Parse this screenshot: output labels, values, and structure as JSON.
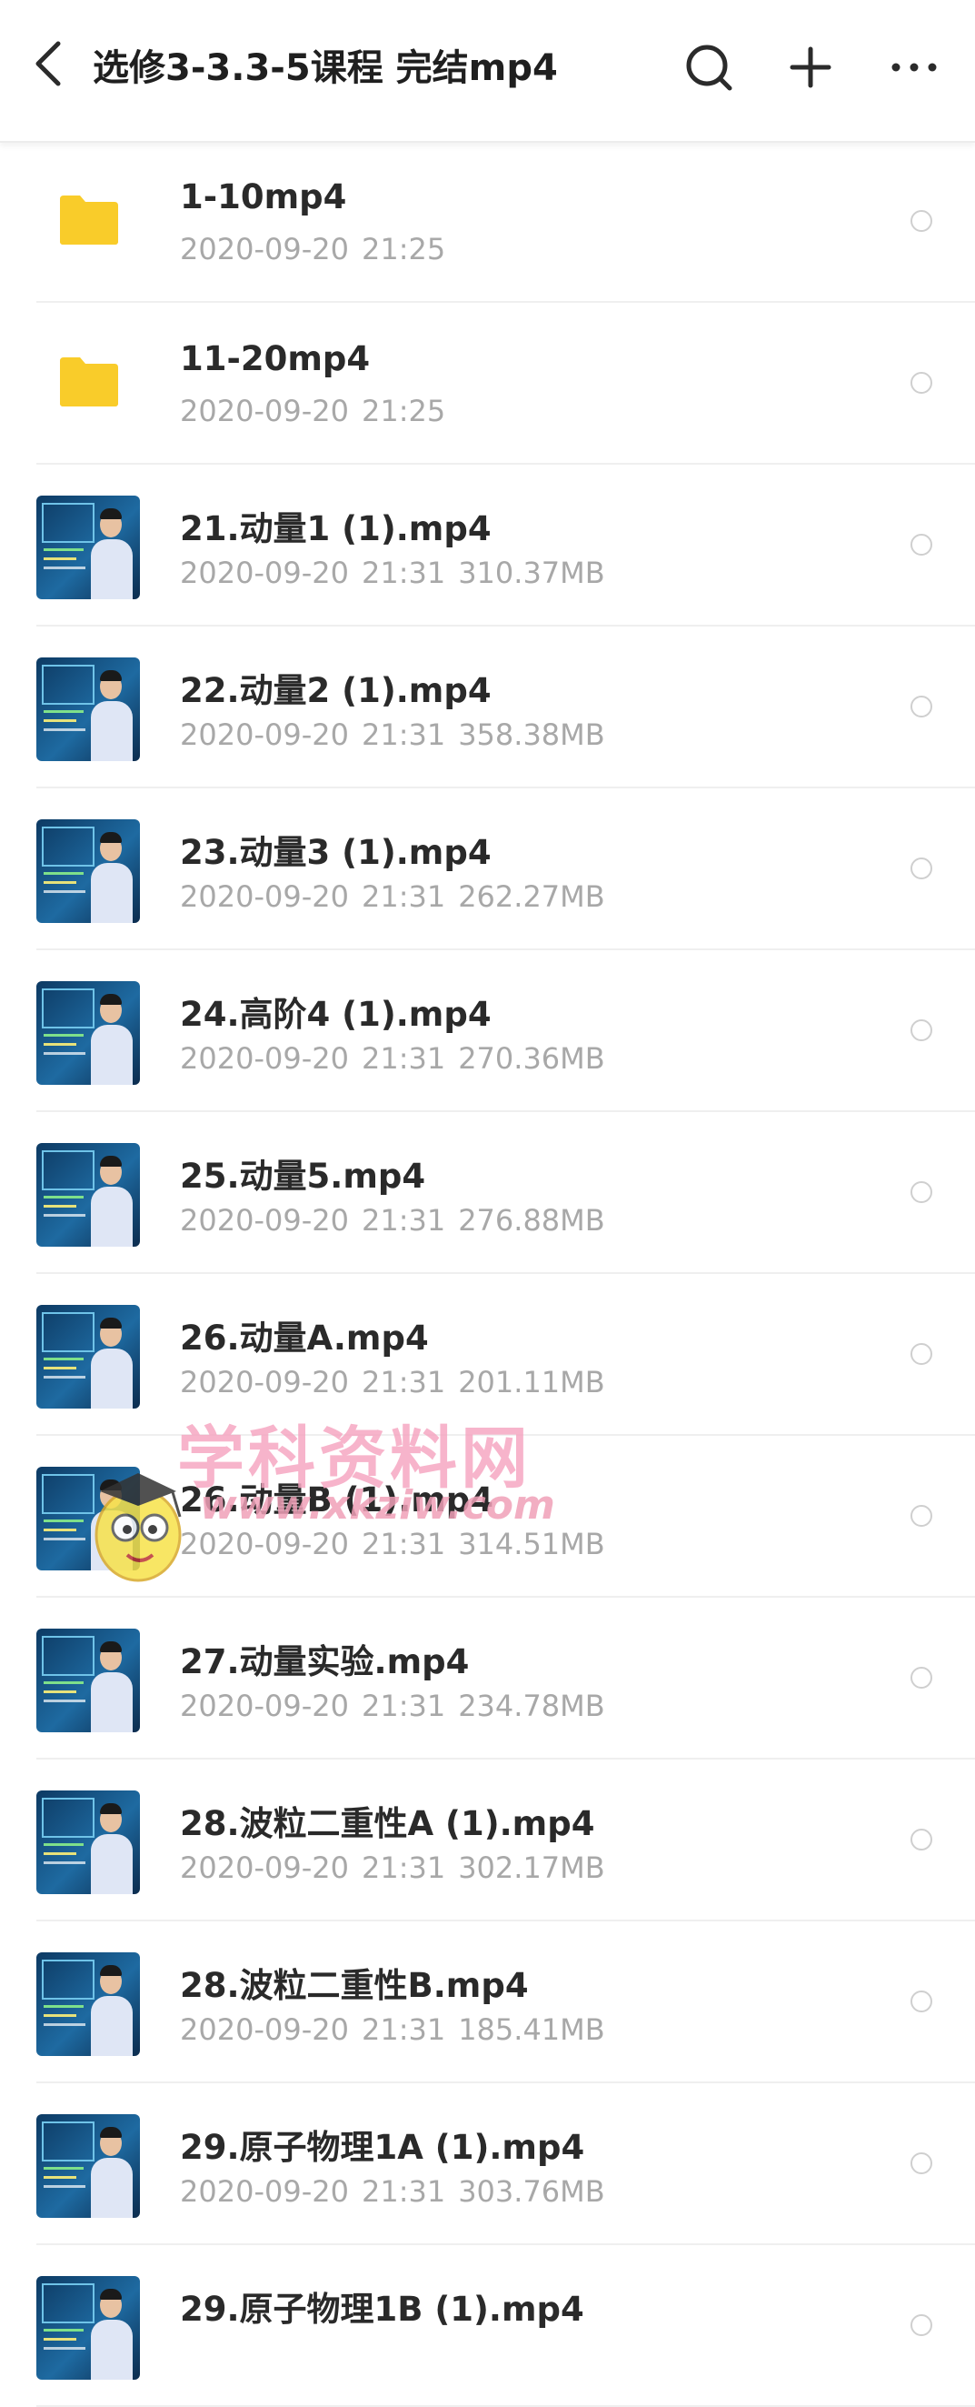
{
  "header": {
    "title": "选修3-3.3-5课程 完结mp4",
    "back_icon": "back-arrow-icon",
    "search_icon": "search-icon",
    "add_icon": "plus-icon",
    "more_icon": "more-dots-icon"
  },
  "colors": {
    "folder": "#F9CC2A",
    "title_text": "#1F1F1F",
    "meta_text": "#A8A8A8"
  },
  "files": [
    {
      "name": "1-10mp4",
      "date": "2020-09-20",
      "time": "21:25",
      "size": "",
      "kind": "folder"
    },
    {
      "name": "11-20mp4",
      "date": "2020-09-20",
      "time": "21:25",
      "size": "",
      "kind": "folder"
    },
    {
      "name": "21.动量1 (1).mp4",
      "date": "2020-09-20",
      "time": "21:31",
      "size": "310.37MB",
      "kind": "video"
    },
    {
      "name": "22.动量2 (1).mp4",
      "date": "2020-09-20",
      "time": "21:31",
      "size": "358.38MB",
      "kind": "video"
    },
    {
      "name": "23.动量3 (1).mp4",
      "date": "2020-09-20",
      "time": "21:31",
      "size": "262.27MB",
      "kind": "video"
    },
    {
      "name": "24.高阶4 (1).mp4",
      "date": "2020-09-20",
      "time": "21:31",
      "size": "270.36MB",
      "kind": "video"
    },
    {
      "name": "25.动量5.mp4",
      "date": "2020-09-20",
      "time": "21:31",
      "size": "276.88MB",
      "kind": "video"
    },
    {
      "name": "26.动量A.mp4",
      "date": "2020-09-20",
      "time": "21:31",
      "size": "201.11MB",
      "kind": "video"
    },
    {
      "name": "26.动量B (1).mp4",
      "date": "2020-09-20",
      "time": "21:31",
      "size": "314.51MB",
      "kind": "video"
    },
    {
      "name": "27.动量实验.mp4",
      "date": "2020-09-20",
      "time": "21:31",
      "size": "234.78MB",
      "kind": "video"
    },
    {
      "name": "28.波粒二重性A (1).mp4",
      "date": "2020-09-20",
      "time": "21:31",
      "size": "302.17MB",
      "kind": "video"
    },
    {
      "name": "28.波粒二重性B.mp4",
      "date": "2020-09-20",
      "time": "21:31",
      "size": "185.41MB",
      "kind": "video"
    },
    {
      "name": "29.原子物理1A (1).mp4",
      "date": "2020-09-20",
      "time": "21:31",
      "size": "303.76MB",
      "kind": "video"
    },
    {
      "name": "29.原子物理1B (1).mp4",
      "date": "",
      "time": "",
      "size": "",
      "kind": "video"
    }
  ],
  "watermark": {
    "text": "学科资料网",
    "url": "www.xkziw.com"
  }
}
